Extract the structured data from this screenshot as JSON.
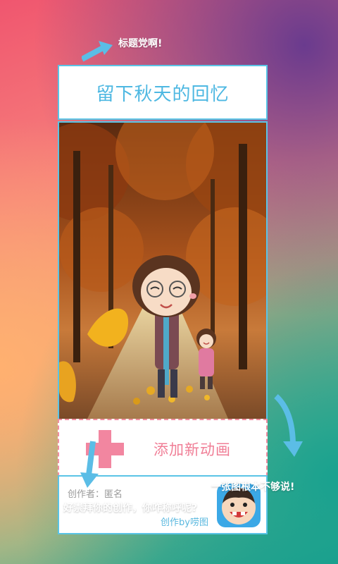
{
  "hints": {
    "title": "标题党啊!",
    "more": "一张图根本不够说!",
    "credit": "好崇拜你的创作，你咋称呼呢?"
  },
  "card": {
    "title": "留下秋天的回忆",
    "add_label": "添加新动画",
    "author": "创作者：匿名",
    "credit": "创作by唠图"
  },
  "colors": {
    "accent": "#5ac4e6",
    "pink": "#f286a0",
    "arrow": "#5bbde6"
  },
  "icons": [
    "arrow-icon",
    "plus-icon",
    "app-logo-icon"
  ]
}
